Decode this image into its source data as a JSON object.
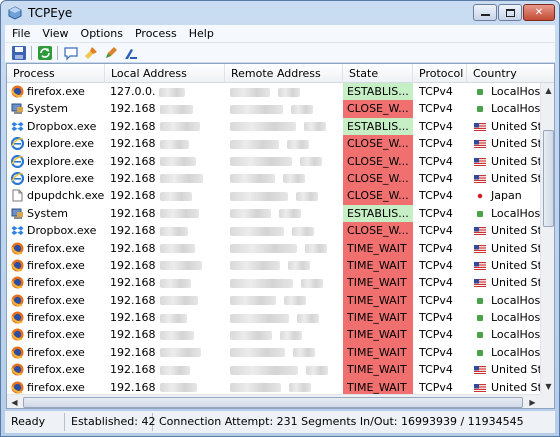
{
  "window": {
    "title": "TCPEye"
  },
  "menu": [
    "File",
    "View",
    "Options",
    "Process",
    "Help"
  ],
  "toolbar": [
    "save-icon",
    "refresh-icon",
    "comment-icon",
    "brush-icon",
    "pen-icon",
    "tool-icon"
  ],
  "columns": [
    "Process",
    "Local Address",
    "Remote Address",
    "State",
    "Protocol",
    "Country"
  ],
  "state_colors": {
    "ESTABLIS...": "#c6efc6",
    "CLOSE_W...": "#f07070",
    "TIME_WAIT": "#f07070"
  },
  "rows": [
    {
      "icon": "firefox",
      "process": "firefox.exe",
      "local": "127.0.0.",
      "state": "ESTABLIS...",
      "protocol": "TCPv4",
      "flag": "local",
      "country": "LocalHost"
    },
    {
      "icon": "system",
      "process": "System",
      "local": "192.168",
      "state": "CLOSE_W...",
      "protocol": "TCPv4",
      "flag": "local",
      "country": "LocalHost"
    },
    {
      "icon": "dropbox",
      "process": "Dropbox.exe",
      "local": "192.168",
      "state": "ESTABLIS...",
      "protocol": "TCPv4",
      "flag": "us",
      "country": "United Stat"
    },
    {
      "icon": "ie",
      "process": "iexplore.exe",
      "local": "192.168",
      "state": "CLOSE_W...",
      "protocol": "TCPv4",
      "flag": "us",
      "country": "United Stat"
    },
    {
      "icon": "ie",
      "process": "iexplore.exe",
      "local": "192.168",
      "state": "CLOSE_W...",
      "protocol": "TCPv4",
      "flag": "us",
      "country": "United Stat"
    },
    {
      "icon": "ie",
      "process": "iexplore.exe",
      "local": "192.168",
      "state": "CLOSE_W...",
      "protocol": "TCPv4",
      "flag": "us",
      "country": "United Stat"
    },
    {
      "icon": "file",
      "process": "dpupdchk.exe",
      "local": "192.168",
      "state": "CLOSE_W...",
      "protocol": "TCPv4",
      "flag": "jp",
      "country": "Japan"
    },
    {
      "icon": "system",
      "process": "System",
      "local": "192.168",
      "state": "ESTABLIS...",
      "protocol": "TCPv4",
      "flag": "local",
      "country": "LocalHost"
    },
    {
      "icon": "dropbox",
      "process": "Dropbox.exe",
      "local": "192.168",
      "state": "CLOSE_W...",
      "protocol": "TCPv4",
      "flag": "us",
      "country": "United Stat"
    },
    {
      "icon": "firefox",
      "process": "firefox.exe",
      "local": "192.168",
      "state": "TIME_WAIT",
      "protocol": "TCPv4",
      "flag": "us",
      "country": "United Stat"
    },
    {
      "icon": "firefox",
      "process": "firefox.exe",
      "local": "192.168",
      "state": "TIME_WAIT",
      "protocol": "TCPv4",
      "flag": "us",
      "country": "United Stat"
    },
    {
      "icon": "firefox",
      "process": "firefox.exe",
      "local": "192.168",
      "state": "TIME_WAIT",
      "protocol": "TCPv4",
      "flag": "us",
      "country": "United Stat"
    },
    {
      "icon": "firefox",
      "process": "firefox.exe",
      "local": "192.168",
      "state": "TIME_WAIT",
      "protocol": "TCPv4",
      "flag": "local",
      "country": "LocalHost"
    },
    {
      "icon": "firefox",
      "process": "firefox.exe",
      "local": "192.168",
      "state": "TIME_WAIT",
      "protocol": "TCPv4",
      "flag": "local",
      "country": "LocalHost"
    },
    {
      "icon": "firefox",
      "process": "firefox.exe",
      "local": "192.168",
      "state": "TIME_WAIT",
      "protocol": "TCPv4",
      "flag": "local",
      "country": "LocalHost"
    },
    {
      "icon": "firefox",
      "process": "firefox.exe",
      "local": "192.168",
      "state": "TIME_WAIT",
      "protocol": "TCPv4",
      "flag": "local",
      "country": "LocalHost"
    },
    {
      "icon": "firefox",
      "process": "firefox.exe",
      "local": "192.168",
      "state": "TIME_WAIT",
      "protocol": "TCPv4",
      "flag": "us",
      "country": "United Stat"
    },
    {
      "icon": "firefox",
      "process": "firefox.exe",
      "local": "192.168",
      "state": "TIME_WAIT",
      "protocol": "TCPv4",
      "flag": "us",
      "country": "United Stat"
    }
  ],
  "status": {
    "ready": "Ready",
    "established": "Established: 42",
    "attempt": "Connection Attempt: 231 Segments In/Out: 16993939 / 11934545"
  }
}
